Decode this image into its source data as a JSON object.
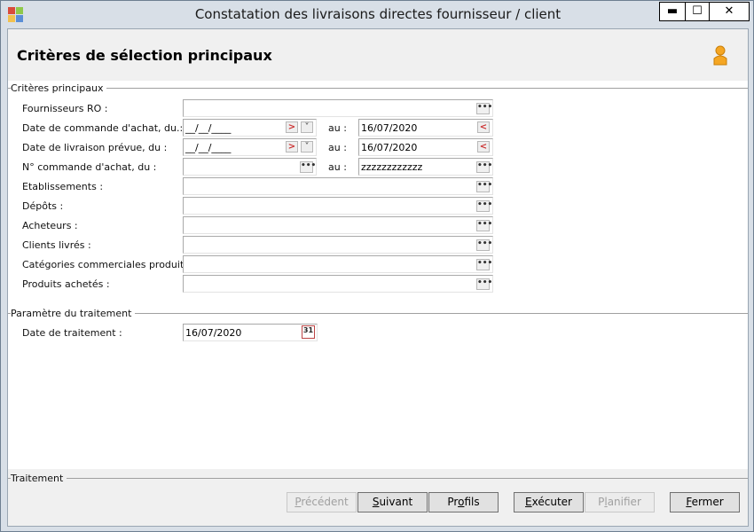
{
  "window": {
    "title": "Constatation des livraisons directes fournisseur / client",
    "minimize_label": "▬",
    "maximize_label": "☐",
    "close_label": "✕"
  },
  "header": {
    "title": "Critères de sélection principaux"
  },
  "groups": {
    "main": "Critères principaux",
    "params": "Paramètre du traitement",
    "treatment": "Traitement"
  },
  "fields": {
    "fournisseurs": {
      "label": "Fournisseurs RO :",
      "value": ""
    },
    "date_commande": {
      "label": "Date de commande d'achat, du.:",
      "from": "__/__/____",
      "to_label": "au :",
      "to": "16/07/2020"
    },
    "date_livraison": {
      "label": "Date de livraison prévue, du :",
      "from": "__/__/____",
      "to_label": "au :",
      "to": "16/07/2020"
    },
    "num_commande": {
      "label": "N° commande d'achat, du :",
      "from": "",
      "to_label": "au :",
      "to": "zzzzzzzzzzzz"
    },
    "etablissements": {
      "label": "Etablissements :",
      "value": ""
    },
    "depots": {
      "label": "Dépôts :",
      "value": ""
    },
    "acheteurs": {
      "label": "Acheteurs :",
      "value": ""
    },
    "clients": {
      "label": "Clients livrés :",
      "value": ""
    },
    "categories": {
      "label": "Catégories commerciales produits :",
      "value": ""
    },
    "produits": {
      "label": "Produits achetés :",
      "value": ""
    },
    "date_traitement": {
      "label": "Date de traitement :",
      "value": "16/07/2020"
    }
  },
  "buttons": {
    "precedent": {
      "pre": "",
      "u": "P",
      "post": "récédent"
    },
    "suivant": {
      "pre": "",
      "u": "S",
      "post": "uivant"
    },
    "profils": {
      "pre": "Pr",
      "u": "o",
      "post": "fils"
    },
    "executer": {
      "pre": "",
      "u": "E",
      "post": "xécuter"
    },
    "planifier": {
      "pre": "P",
      "u": "l",
      "post": "anifier"
    },
    "fermer": {
      "pre": "",
      "u": "F",
      "post": "ermer"
    }
  },
  "icons": {
    "app": "app-icon",
    "user": "user-icon",
    "ellipsis": "ellipsis-icon",
    "calendar": "calendar-icon",
    "calendar_day": "31"
  },
  "colors": {
    "titlebar": "#d8dfe7",
    "user_icon": "#f5a623"
  }
}
